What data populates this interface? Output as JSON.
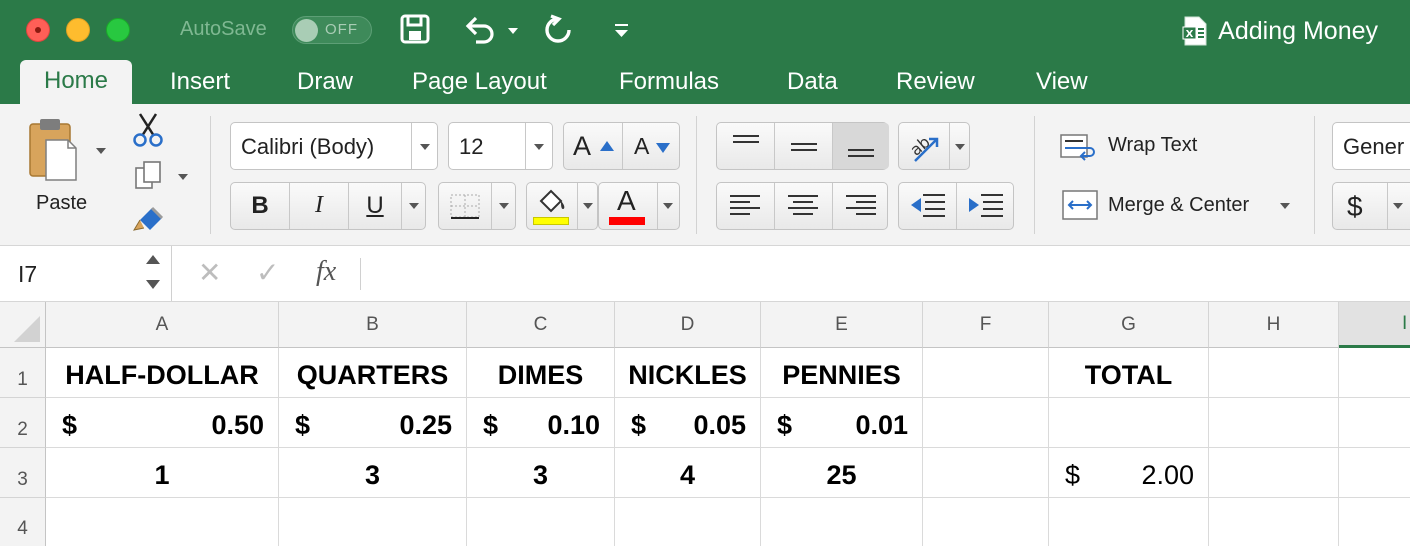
{
  "titlebar": {
    "autosave_label": "AutoSave",
    "autosave_state": "OFF",
    "document_title": "Adding Money"
  },
  "tabs": [
    "Home",
    "Insert",
    "Draw",
    "Page Layout",
    "Formulas",
    "Data",
    "Review",
    "View"
  ],
  "active_tab": "Home",
  "ribbon": {
    "paste_label": "Paste",
    "font_name": "Calibri (Body)",
    "font_size": "12",
    "bold_label": "B",
    "italic_label": "I",
    "underline_label": "U",
    "font_color_label": "A",
    "grow_font_label": "A",
    "shrink_font_label": "A",
    "wrap_text_label": "Wrap Text",
    "merge_center_label": "Merge & Center",
    "number_format": "Gener",
    "currency_label": "$",
    "highlight_color": "#ffff00",
    "font_color": "#ff0000"
  },
  "formula_bar": {
    "name_box": "I7",
    "fx_label": "fx",
    "cancel_symbol": "✕",
    "enter_symbol": "✓",
    "content": ""
  },
  "grid": {
    "columns": [
      "A",
      "B",
      "C",
      "D",
      "E",
      "F",
      "G",
      "H",
      "I"
    ],
    "rows": [
      "1",
      "2",
      "3",
      "4"
    ],
    "row1": {
      "A": "HALF-DOLLAR",
      "B": "QUARTERS",
      "C": "DIMES",
      "D": "NICKLES",
      "E": "PENNIES",
      "G": "TOTAL"
    },
    "row2": {
      "currency": "$",
      "A": "0.50",
      "B": "0.25",
      "C": "0.10",
      "D": "0.05",
      "E": "0.01"
    },
    "row3": {
      "A": "1",
      "B": "3",
      "C": "3",
      "D": "4",
      "E": "25",
      "G_currency": "$",
      "G": "2.00"
    }
  },
  "colors": {
    "app_green": "#2b7a48",
    "ribbon_bg": "#f3f3f3",
    "selected_column_indicator": "#2b7a48"
  }
}
